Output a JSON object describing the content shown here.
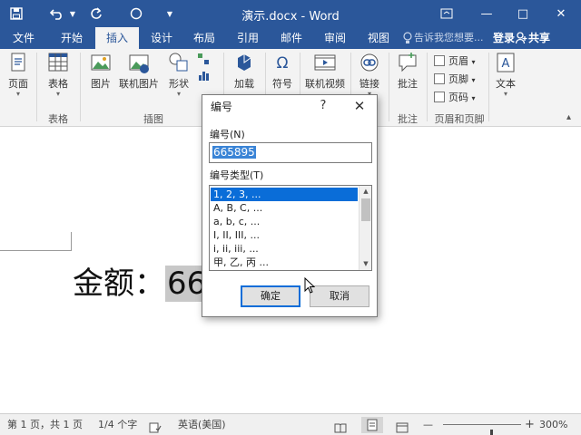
{
  "titlebar": {
    "doc_title": "演示.docx - Word",
    "save_icon": "save-icon",
    "undo_icon": "undo-icon",
    "repeat_icon": "repeat-icon",
    "circle_icon": "circle-icon",
    "customize_icon": "customize-icon"
  },
  "window": {
    "ribbon_display": "⬜",
    "minimize": "—",
    "maximize": "□",
    "close": "✕"
  },
  "tabs": [
    "文件",
    "开始",
    "插入",
    "设计",
    "布局",
    "引用",
    "邮件",
    "审阅",
    "视图"
  ],
  "active_tab": "插入",
  "tell_me": "告诉我您想要...",
  "login": "登录",
  "share": "共享",
  "ribbon": {
    "page": "页面",
    "table": "表格",
    "picture": "图片",
    "online_picture": "联机图片",
    "shapes": "形状",
    "addins": "加载",
    "symbol": "符号",
    "online_video": "联机视频",
    "link": "链接",
    "comment": "批注",
    "header": "页眉",
    "footer": "页脚",
    "page_number": "页码",
    "text": "文本",
    "groups": {
      "tables": "表格",
      "illustrations": "插图",
      "comments": "批注",
      "header_footer": "页眉和页脚"
    }
  },
  "document": {
    "text_prefix": "金额：",
    "text_highlight": "66"
  },
  "status": {
    "page": "第 1 页，共 1 页",
    "words": "1/4 个字",
    "language": "英语(美国)",
    "zoom": "300%",
    "zoom_minus": "—",
    "zoom_plus": "+",
    "zoom_level": 0.6
  },
  "dialog": {
    "title": "编号",
    "help": "?",
    "close": "✕",
    "number_label": "编号(N)",
    "number_value": "665895",
    "type_label": "编号类型(T)",
    "types": [
      "1, 2, 3, ...",
      "A, B, C, ...",
      "a, b, c, ...",
      "I, II, III, ...",
      "i, ii, iii, ...",
      "甲, 乙, 丙 ..."
    ],
    "selected_type": "1, 2, 3, ...",
    "ok": "确定",
    "cancel": "取消"
  },
  "colors": {
    "word_blue": "#2b579a",
    "selection_blue": "#0a6dd8"
  }
}
